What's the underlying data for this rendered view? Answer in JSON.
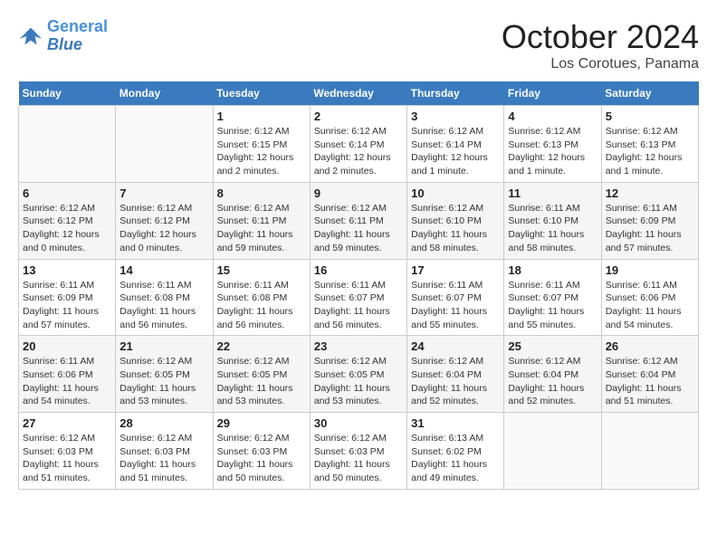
{
  "header": {
    "logo_line1": "General",
    "logo_line2": "Blue",
    "month_title": "October 2024",
    "location": "Los Corotues, Panama"
  },
  "weekdays": [
    "Sunday",
    "Monday",
    "Tuesday",
    "Wednesday",
    "Thursday",
    "Friday",
    "Saturday"
  ],
  "weeks": [
    [
      {
        "day": "",
        "info": ""
      },
      {
        "day": "",
        "info": ""
      },
      {
        "day": "1",
        "info": "Sunrise: 6:12 AM\nSunset: 6:15 PM\nDaylight: 12 hours and 2 minutes."
      },
      {
        "day": "2",
        "info": "Sunrise: 6:12 AM\nSunset: 6:14 PM\nDaylight: 12 hours and 2 minutes."
      },
      {
        "day": "3",
        "info": "Sunrise: 6:12 AM\nSunset: 6:14 PM\nDaylight: 12 hours and 1 minute."
      },
      {
        "day": "4",
        "info": "Sunrise: 6:12 AM\nSunset: 6:13 PM\nDaylight: 12 hours and 1 minute."
      },
      {
        "day": "5",
        "info": "Sunrise: 6:12 AM\nSunset: 6:13 PM\nDaylight: 12 hours and 1 minute."
      }
    ],
    [
      {
        "day": "6",
        "info": "Sunrise: 6:12 AM\nSunset: 6:12 PM\nDaylight: 12 hours and 0 minutes."
      },
      {
        "day": "7",
        "info": "Sunrise: 6:12 AM\nSunset: 6:12 PM\nDaylight: 12 hours and 0 minutes."
      },
      {
        "day": "8",
        "info": "Sunrise: 6:12 AM\nSunset: 6:11 PM\nDaylight: 11 hours and 59 minutes."
      },
      {
        "day": "9",
        "info": "Sunrise: 6:12 AM\nSunset: 6:11 PM\nDaylight: 11 hours and 59 minutes."
      },
      {
        "day": "10",
        "info": "Sunrise: 6:12 AM\nSunset: 6:10 PM\nDaylight: 11 hours and 58 minutes."
      },
      {
        "day": "11",
        "info": "Sunrise: 6:11 AM\nSunset: 6:10 PM\nDaylight: 11 hours and 58 minutes."
      },
      {
        "day": "12",
        "info": "Sunrise: 6:11 AM\nSunset: 6:09 PM\nDaylight: 11 hours and 57 minutes."
      }
    ],
    [
      {
        "day": "13",
        "info": "Sunrise: 6:11 AM\nSunset: 6:09 PM\nDaylight: 11 hours and 57 minutes."
      },
      {
        "day": "14",
        "info": "Sunrise: 6:11 AM\nSunset: 6:08 PM\nDaylight: 11 hours and 56 minutes."
      },
      {
        "day": "15",
        "info": "Sunrise: 6:11 AM\nSunset: 6:08 PM\nDaylight: 11 hours and 56 minutes."
      },
      {
        "day": "16",
        "info": "Sunrise: 6:11 AM\nSunset: 6:07 PM\nDaylight: 11 hours and 56 minutes."
      },
      {
        "day": "17",
        "info": "Sunrise: 6:11 AM\nSunset: 6:07 PM\nDaylight: 11 hours and 55 minutes."
      },
      {
        "day": "18",
        "info": "Sunrise: 6:11 AM\nSunset: 6:07 PM\nDaylight: 11 hours and 55 minutes."
      },
      {
        "day": "19",
        "info": "Sunrise: 6:11 AM\nSunset: 6:06 PM\nDaylight: 11 hours and 54 minutes."
      }
    ],
    [
      {
        "day": "20",
        "info": "Sunrise: 6:11 AM\nSunset: 6:06 PM\nDaylight: 11 hours and 54 minutes."
      },
      {
        "day": "21",
        "info": "Sunrise: 6:12 AM\nSunset: 6:05 PM\nDaylight: 11 hours and 53 minutes."
      },
      {
        "day": "22",
        "info": "Sunrise: 6:12 AM\nSunset: 6:05 PM\nDaylight: 11 hours and 53 minutes."
      },
      {
        "day": "23",
        "info": "Sunrise: 6:12 AM\nSunset: 6:05 PM\nDaylight: 11 hours and 53 minutes."
      },
      {
        "day": "24",
        "info": "Sunrise: 6:12 AM\nSunset: 6:04 PM\nDaylight: 11 hours and 52 minutes."
      },
      {
        "day": "25",
        "info": "Sunrise: 6:12 AM\nSunset: 6:04 PM\nDaylight: 11 hours and 52 minutes."
      },
      {
        "day": "26",
        "info": "Sunrise: 6:12 AM\nSunset: 6:04 PM\nDaylight: 11 hours and 51 minutes."
      }
    ],
    [
      {
        "day": "27",
        "info": "Sunrise: 6:12 AM\nSunset: 6:03 PM\nDaylight: 11 hours and 51 minutes."
      },
      {
        "day": "28",
        "info": "Sunrise: 6:12 AM\nSunset: 6:03 PM\nDaylight: 11 hours and 51 minutes."
      },
      {
        "day": "29",
        "info": "Sunrise: 6:12 AM\nSunset: 6:03 PM\nDaylight: 11 hours and 50 minutes."
      },
      {
        "day": "30",
        "info": "Sunrise: 6:12 AM\nSunset: 6:03 PM\nDaylight: 11 hours and 50 minutes."
      },
      {
        "day": "31",
        "info": "Sunrise: 6:13 AM\nSunset: 6:02 PM\nDaylight: 11 hours and 49 minutes."
      },
      {
        "day": "",
        "info": ""
      },
      {
        "day": "",
        "info": ""
      }
    ]
  ]
}
